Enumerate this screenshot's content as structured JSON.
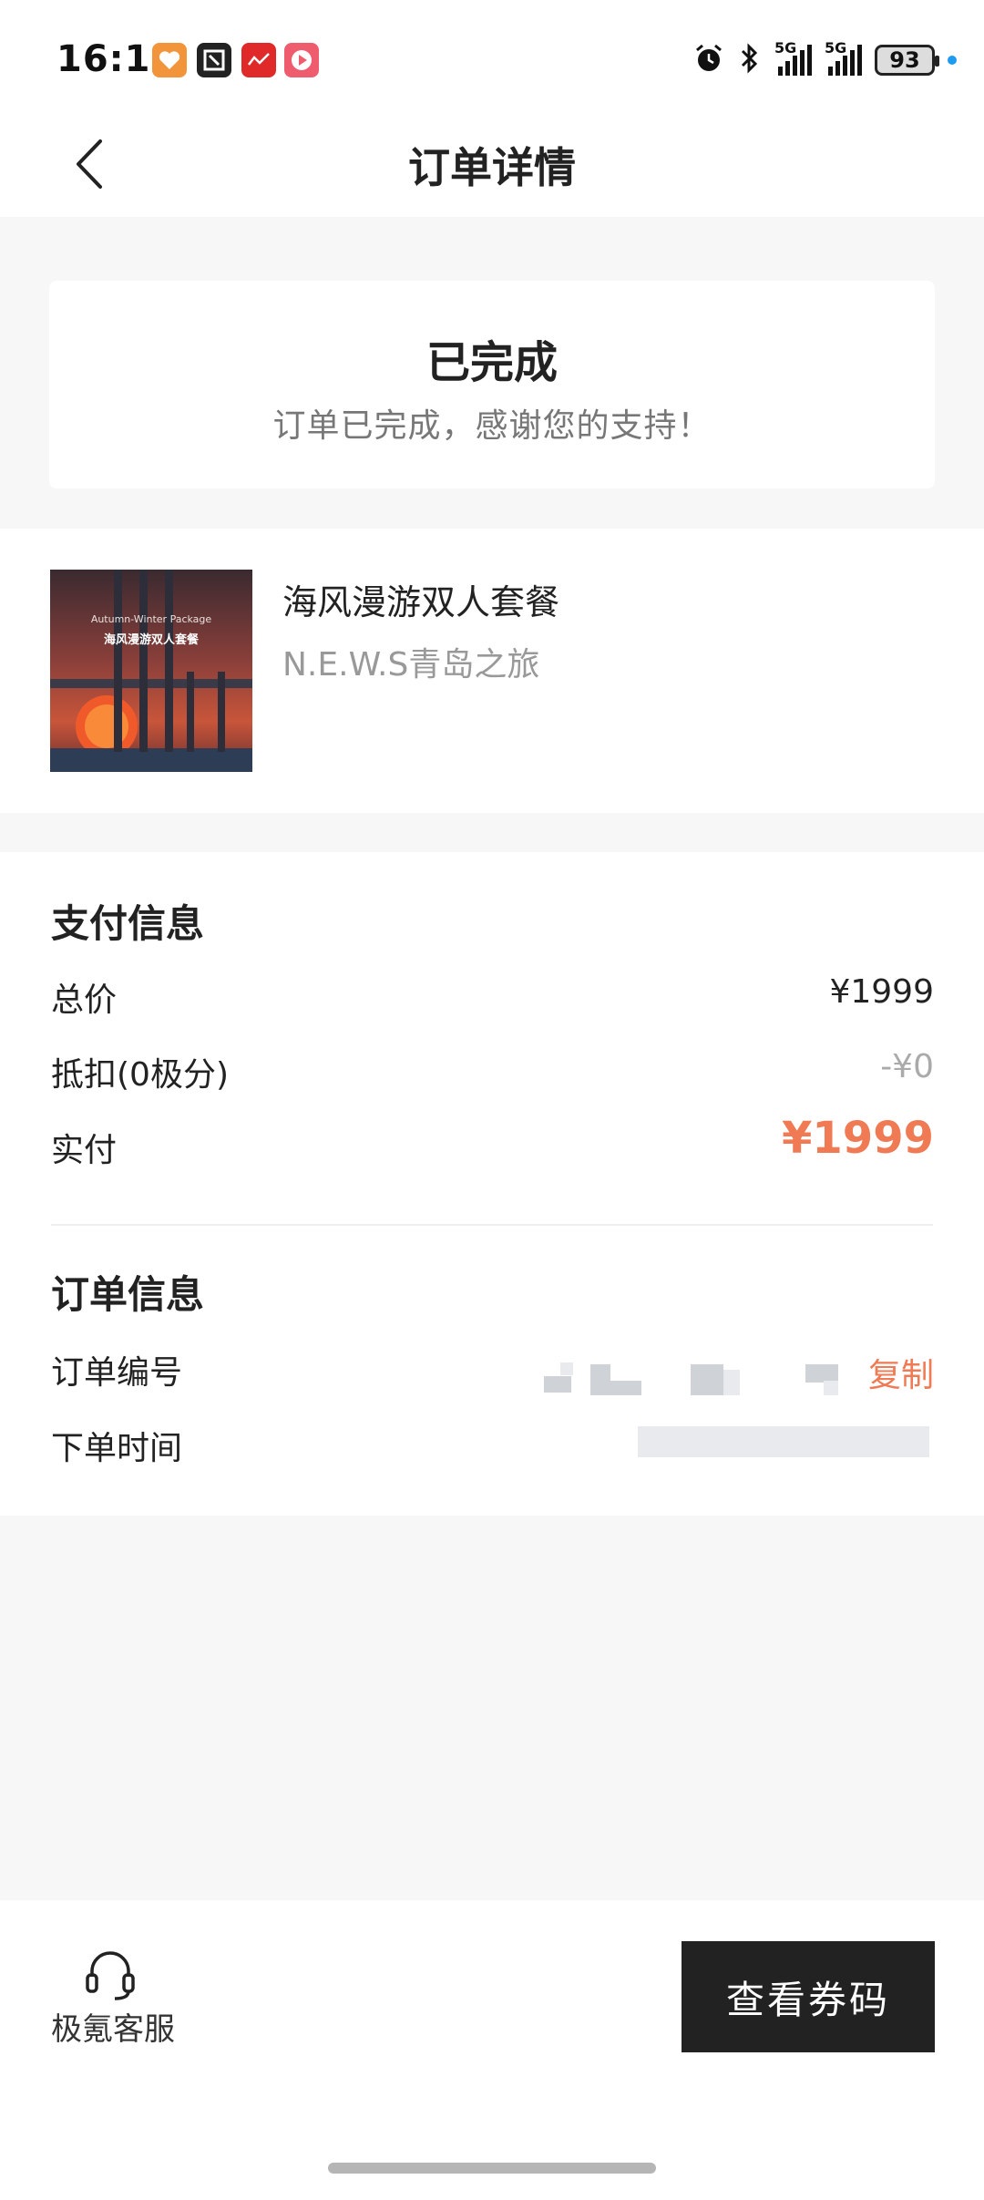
{
  "status_bar": {
    "time": "16:11",
    "signal_1": "5G",
    "signal_2": "5G",
    "battery": "93"
  },
  "header": {
    "title": "订单详情"
  },
  "order_status": {
    "title": "已完成",
    "subtitle": "订单已完成，感谢您的支持！"
  },
  "product": {
    "name": "海风漫游双人套餐",
    "subtitle": "N.E.W.S青岛之旅",
    "image_caption_en": "Autumn-Winter Package",
    "image_caption_cn": "海风漫游双人套餐"
  },
  "payment": {
    "section_title": "支付信息",
    "total_label": "总价",
    "total_value": "¥1999",
    "deduction_label": "抵扣(0极分)",
    "deduction_value": "-¥0",
    "paid_label": "实付",
    "paid_value": "¥1999"
  },
  "order_info": {
    "section_title": "订单信息",
    "number_label": "订单编号",
    "copy_label": "复制",
    "time_label": "下单时间"
  },
  "bottom_bar": {
    "service_label": "极氪客服",
    "voucher_button": "查看券码"
  },
  "colors": {
    "accent": "#ef7a54",
    "button_bg": "#222222",
    "page_bg": "#f7f7f7"
  },
  "icons": {
    "back": "chevron-left-icon",
    "service": "headset-icon"
  }
}
